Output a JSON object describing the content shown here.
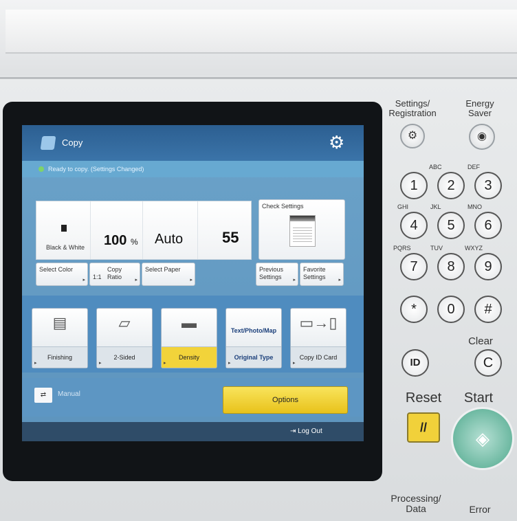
{
  "screen": {
    "header_title": "Copy",
    "status_text": "Ready to copy. (Settings Changed)",
    "color_mode_label": "Black & White",
    "copy_ratio_value": "100",
    "copy_ratio_unit": "%",
    "paper_value": "Auto",
    "copies_value": "55",
    "check_settings_label": "Check Settings",
    "buttons": {
      "select_color": "Select Color",
      "ratio_prefix": "1:1",
      "copy_ratio": "Copy Ratio",
      "select_paper": "Select Paper",
      "previous_settings": "Previous Settings",
      "favorite_settings": "Favorite Settings"
    },
    "functions": [
      {
        "label": "Finishing"
      },
      {
        "label": "2-Sided"
      },
      {
        "label": "Density"
      },
      {
        "label": "Original Type",
        "icon_text": "Text/Photo/Map"
      },
      {
        "label": "Copy ID Card"
      }
    ],
    "manual_label": "Manual",
    "options_label": "Options",
    "logout_label": "Log Out"
  },
  "hardware": {
    "settings_registration": "Settings/ Registration",
    "energy_saver": "Energy Saver",
    "keys": [
      {
        "digit": "1",
        "letters": ""
      },
      {
        "digit": "2",
        "letters": "ABC"
      },
      {
        "digit": "3",
        "letters": "DEF"
      },
      {
        "digit": "4",
        "letters": "GHI"
      },
      {
        "digit": "5",
        "letters": "JKL"
      },
      {
        "digit": "6",
        "letters": "MNO"
      },
      {
        "digit": "7",
        "letters": "PQRS"
      },
      {
        "digit": "8",
        "letters": "TUV"
      },
      {
        "digit": "9",
        "letters": "WXYZ"
      },
      {
        "digit": "*",
        "letters": ""
      },
      {
        "digit": "0",
        "letters": ""
      },
      {
        "digit": "#",
        "letters": ""
      }
    ],
    "clear_label": "Clear",
    "clear_key": "C",
    "id_key": "ID",
    "reset_label": "Reset",
    "start_label": "Start",
    "processing_label": "Processing/ Data",
    "error_label": "Error"
  }
}
